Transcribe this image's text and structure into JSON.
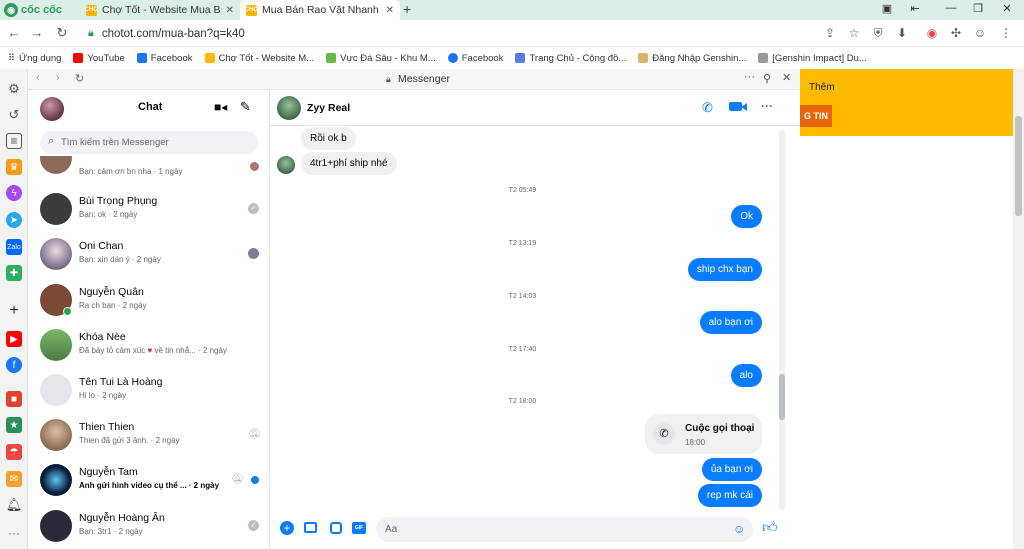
{
  "browser": {
    "logo": "cốc cốc",
    "tabs": [
      {
        "label": "Chợ Tốt - Website Mua Bán,",
        "favicon": "CHỢ"
      },
      {
        "label": "Mua Bán Rao Vặt Nhanh Chó",
        "favicon": "CHỢ"
      }
    ],
    "url": "chotot.com/mua-ban?q=k40",
    "bookmarks": [
      "Ứng dụng",
      "YouTube",
      "Facebook",
      "Chợ Tốt - Website M...",
      "Vực Đá Sâu - Khu M...",
      "Facebook",
      "Trang Chủ - Cộng đồ...",
      "Đăng Nhập Genshin...",
      "[Genshin Impact] Du..."
    ]
  },
  "panel": {
    "title": "Messenger"
  },
  "chatlist": {
    "title": "Chat",
    "search_placeholder": "Tìm kiếm trên Messenger",
    "first_preview": "Bạn: cảm ơn bn nha · 1 ngày",
    "conversations": [
      {
        "name": "Bùi Trọng Phụng",
        "preview": "Bạn: ok · 2 ngày"
      },
      {
        "name": "Oni Chan",
        "preview": "Bạn: xin dán ý · 2 ngày"
      },
      {
        "name": "Nguyễn Quân",
        "preview": "Ra ch bạn · 2 ngày"
      },
      {
        "name": "Khóa Nèe",
        "preview_a": "Đã bày tỏ cảm xúc",
        "preview_b": "về tin nhắ... · 2 ngày"
      },
      {
        "name": "Tên Tui Là Hoàng",
        "preview": "Hi lo · 2 ngày"
      },
      {
        "name": "Thien Thien",
        "preview": "Thien đã gửi 3 ảnh. · 2 ngày"
      },
      {
        "name": "Nguyễn Tam",
        "preview": "Anh gửi hình video cụ thể ... · 2 ngày"
      },
      {
        "name": "Nguyễn Hoàng Ân",
        "preview": "Bạn: 3tr1 · 2 ngày"
      }
    ]
  },
  "conversation": {
    "contact": "Zyy Real",
    "messages": {
      "m1": "Rồi ok b",
      "m2": "4tr1+phí ship nhé",
      "t1": "T2 05:49",
      "m3": "Ok",
      "t2": "T2 13:19",
      "m4": "ship chx bạn",
      "t3": "T2 14:03",
      "m5": "alo bạn ơi",
      "t4": "T2 17:40",
      "m6": "alo",
      "t5": "T2 18:00",
      "call_title": "Cuộc gọi thoại",
      "call_time": "18:00",
      "m7": "ủa bạn ơi",
      "m8": "rep mk cái"
    },
    "composer_placeholder": "Aa"
  },
  "webpage": {
    "more_label": "Thêm",
    "button_label": "G TIN"
  },
  "colors": {
    "messenger_blue": "#0a7cff",
    "chotot_yellow": "#ffba00",
    "coccoc_green": "#2d9b5a"
  }
}
